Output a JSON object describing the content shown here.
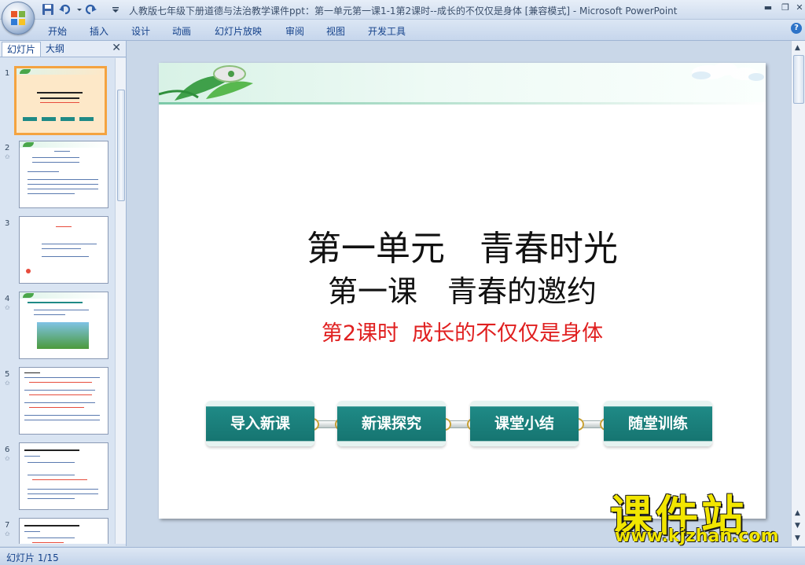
{
  "window": {
    "title": "人教版七年级下册道德与法治教学课件ppt：第一单元第一课1-1第2课时--成长的不仅仅是身体 [兼容模式] - Microsoft PowerPoint"
  },
  "ribbon": {
    "tabs": [
      "开始",
      "插入",
      "设计",
      "动画",
      "幻灯片放映",
      "审阅",
      "视图",
      "开发工具"
    ]
  },
  "left_pane": {
    "tabs": [
      "幻灯片",
      "大纲"
    ],
    "thumbnails": [
      {
        "num": "1",
        "star": ""
      },
      {
        "num": "2",
        "star": "✩"
      },
      {
        "num": "3",
        "star": ""
      },
      {
        "num": "4",
        "star": "✩"
      },
      {
        "num": "5",
        "star": "✩"
      },
      {
        "num": "6",
        "star": "✩"
      },
      {
        "num": "7",
        "star": "✩"
      }
    ]
  },
  "slide": {
    "line1": "第一单元　青春时光",
    "line2": "第一课　青春的邀约",
    "line3": "第2课时  成长的不仅仅是身体",
    "nav_buttons": [
      "导入新课",
      "新课探究",
      "课堂小结",
      "随堂训练"
    ]
  },
  "watermark": {
    "main": "课件站",
    "url": "www.kjzhan.com"
  },
  "status": {
    "slide_info": "幻灯片 1/15"
  },
  "colors": {
    "accent_button": "#1f8a86",
    "subtitle_red": "#e02020",
    "watermark_yellow": "#f2e600",
    "selected_thumb": "#f4a340"
  }
}
